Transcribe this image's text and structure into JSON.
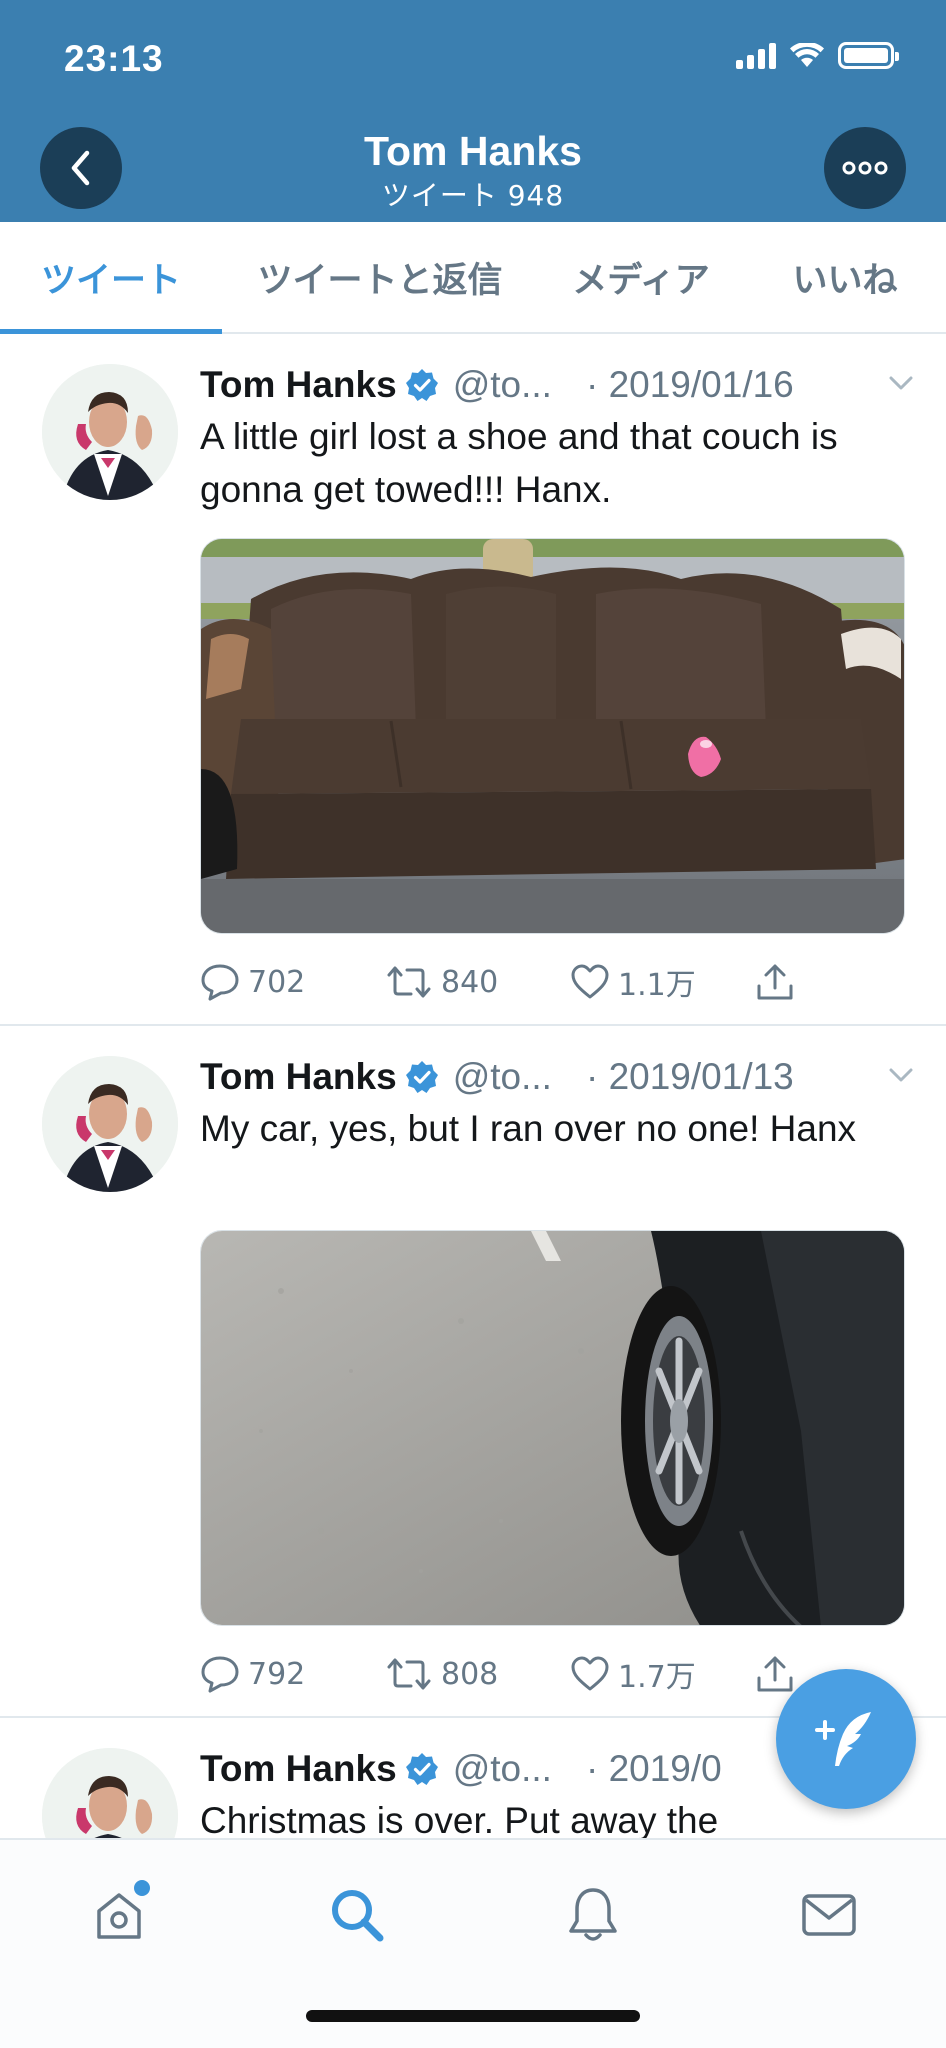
{
  "status_bar": {
    "time": "23:13"
  },
  "header": {
    "title": "Tom Hanks",
    "subtitle": "ツイート 948"
  },
  "tabs": [
    {
      "label": "ツイート",
      "active": true
    },
    {
      "label": "ツイートと返信",
      "active": false
    },
    {
      "label": "メディア",
      "active": false
    },
    {
      "label": "いいね",
      "active": false
    }
  ],
  "tweets": [
    {
      "name": "Tom Hanks",
      "handle": "@to...",
      "date": "· 2019/01/16",
      "text": "A little girl lost a shoe and that couch is gonna get towed!!!  Hanx.",
      "replies": "702",
      "retweets": "840",
      "likes": "1.1万"
    },
    {
      "name": "Tom Hanks",
      "handle": "@to...",
      "date": "· 2019/01/13",
      "text": "My car, yes, but I ran over no one! Hanx",
      "replies": "792",
      "retweets": "808",
      "likes": "1.7万"
    },
    {
      "name": "Tom Hanks",
      "handle": "@to...",
      "date": "· 2019/0",
      "text": "Christmas is over. Put away the"
    }
  ],
  "colors": {
    "header_bg": "#3b7fb0",
    "accent": "#3b94d9",
    "verified": "#3b94d9",
    "muted": "#657786"
  },
  "icons": {
    "back": "chevron-left-icon",
    "more": "ellipsis-icon",
    "reply": "reply-icon",
    "retweet": "retweet-icon",
    "like": "heart-icon",
    "share": "share-icon",
    "compose": "compose-icon",
    "home": "home-icon",
    "search": "search-icon",
    "notifications": "bell-icon",
    "messages": "mail-icon"
  }
}
